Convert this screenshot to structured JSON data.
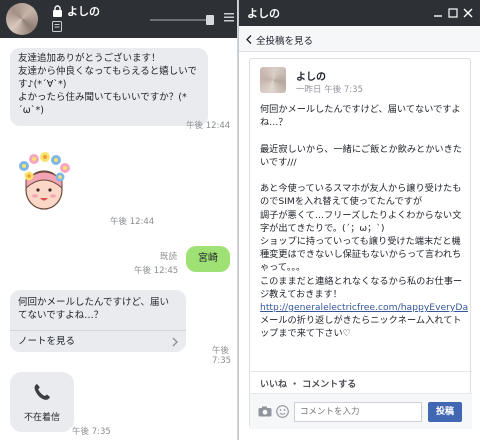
{
  "chat": {
    "contact_name": "よしの",
    "messages": [
      {
        "text": "友達追加ありがとうございます！\n友達から仲良くなってもらえると嬉しいです♪(*´∀`*)\nよかったら住み聞いてもいいですか？(*´ω`*)",
        "time": "午後 12:44"
      },
      {
        "sticker": "girl-flowers-sticker",
        "time": "午後 12:44"
      },
      {
        "text": "宮崎",
        "read": "既読",
        "time": "午後 12:45"
      },
      {
        "text": "何回かメールしたんですけど、届いてないですよね…？",
        "note_link": "ノートを見る",
        "time": "午後 7:35"
      },
      {
        "text": "不在着信",
        "icon": "phone-icon",
        "time": "午後 7:35"
      }
    ]
  },
  "panel": {
    "back_label": "全投稿を見る",
    "post": {
      "author": "よしの",
      "meta": "一昨日 午後 7:35",
      "body_text": "何回かメールしたんですけど、届いてないですよね…？\n\n最近寂しいから、一緒にご飯とか飲みとかいきたいです///\n\nあと今使っているスマホが友人から譲り受けたものでSIMを入れ替えて使ってたんですが\n調子が悪くて…フリーズしたりよくわからない文字が出てきたりで。(´；ω；`)\nショップに持っていっても譲り受けた端末だと機種変更はできないし保証もないからって言われちゃって。。。\nこのままだと連絡とれなくなるから私のお仕事ージ教えておきます！",
      "link": "http://generalelectricfree.com/happyEveryDay/",
      "body_after": "メールの折り返しがきたらニックネーム入れてトップまで来て下さい♡",
      "like": "いいね",
      "comment": "コメントする",
      "comment_placeholder": "コメントを入力",
      "post_button": "投稿"
    }
  },
  "colors": {
    "header_bg": "#2d3035",
    "my_bubble": "#9fe174",
    "other_bubble": "#e9ebee",
    "link": "#365899",
    "post_button": "#4267b2"
  }
}
